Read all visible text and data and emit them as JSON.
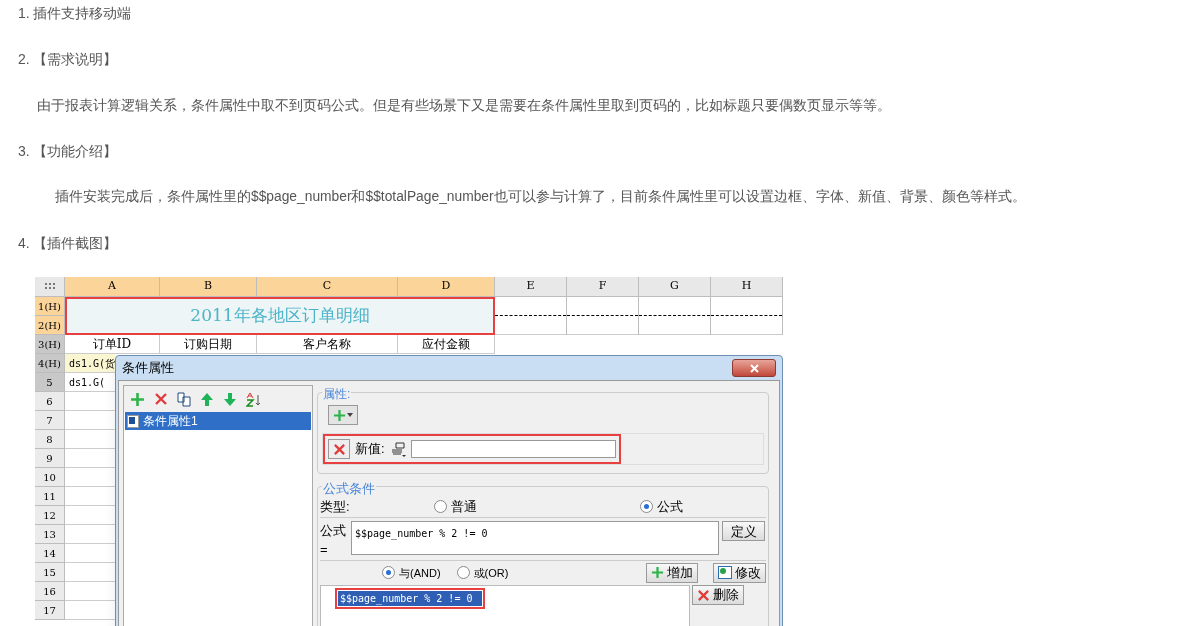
{
  "article": [
    {
      "kind": "heading",
      "number": "1.",
      "text": "插件支持移动端"
    },
    {
      "kind": "heading",
      "number": "2.",
      "text": "【需求说明】"
    },
    {
      "kind": "paragraph",
      "text": "由于报表计算逻辑关系，条件属性中取不到页码公式。但是有些场景下又是需要在条件属性里取到页码的，比如标题只要偶数页显示等等。"
    },
    {
      "kind": "heading",
      "number": "3.",
      "text": "【功能介绍】"
    },
    {
      "kind": "note",
      "text": "插件安装完成后，条件属性里的$$page_number和$$totalPage_number也可以参与计算了，目前条件属性里可以设置边框、字体、新值、背景、颜色等样式。"
    },
    {
      "kind": "heading",
      "number": "4.",
      "text": "【插件截图】"
    }
  ],
  "sheet": {
    "columns": [
      {
        "label": "A",
        "selected": true
      },
      {
        "label": "B",
        "selected": true
      },
      {
        "label": "C",
        "selected": true
      },
      {
        "label": "D",
        "selected": true
      },
      {
        "label": "E",
        "selected": false
      },
      {
        "label": "F",
        "selected": false
      },
      {
        "label": "G",
        "selected": false
      },
      {
        "label": "H",
        "selected": false
      }
    ],
    "rows": [
      {
        "label": "1(H)",
        "selected": true,
        "shaded": false
      },
      {
        "label": "2(H)",
        "selected": true,
        "shaded": false
      },
      {
        "label": "3(H)",
        "selected": false,
        "shaded": true
      },
      {
        "label": "4(H)",
        "selected": false,
        "shaded": true
      },
      {
        "label": "5",
        "selected": false,
        "shaded": true
      },
      {
        "label": "6",
        "selected": false,
        "shaded": false
      },
      {
        "label": "7",
        "selected": false,
        "shaded": false
      },
      {
        "label": "8",
        "selected": false,
        "shaded": false
      },
      {
        "label": "9",
        "selected": false,
        "shaded": false
      },
      {
        "label": "10",
        "selected": false,
        "shaded": false
      },
      {
        "label": "11",
        "selected": false,
        "shaded": false
      },
      {
        "label": "12",
        "selected": false,
        "shaded": false
      },
      {
        "label": "13",
        "selected": false,
        "shaded": false
      },
      {
        "label": "14",
        "selected": false,
        "shaded": false
      },
      {
        "label": "15",
        "selected": false,
        "shaded": false
      },
      {
        "label": "16",
        "selected": false,
        "shaded": false
      },
      {
        "label": "17",
        "selected": false,
        "shaded": false
      }
    ],
    "title_cell": "2011年各地区订单明细",
    "header_cells": [
      "订单ID",
      "订购日期",
      "客户名称",
      "应付金额"
    ],
    "data_cells": [
      "ds1.G(货",
      "ds1.G("
    ]
  },
  "dialog": {
    "title": "条件属性",
    "list": [
      {
        "label": "条件属性1",
        "selected": true
      }
    ],
    "properties_legend": "属性:",
    "new_value_label": "新值:",
    "condition_legend": "公式条件",
    "type_label": "类型:",
    "types": [
      {
        "label": "普通",
        "selected": false
      },
      {
        "label": "公式",
        "selected": true
      }
    ],
    "formula_label": "公式=",
    "formula": "$$page_number % 2 != 0",
    "define_button": "定义",
    "joins": [
      {
        "label": "与(AND)",
        "selected": true
      },
      {
        "label": "或(OR)",
        "selected": false
      }
    ],
    "add_button": "增加",
    "edit_button": "修改",
    "conditions": [
      {
        "text": "$$page_number % 2 != 0",
        "selected": true
      }
    ],
    "delete_button": "删除"
  }
}
